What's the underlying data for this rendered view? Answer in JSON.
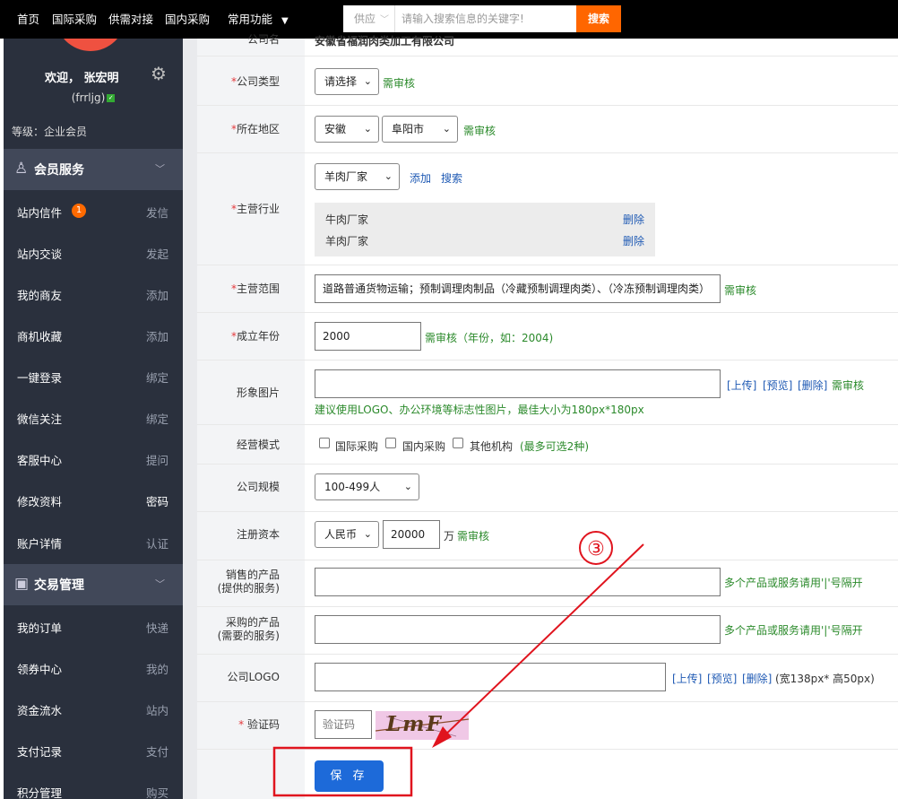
{
  "topnav": {
    "items": [
      "首页",
      "国际采购",
      "供需对接",
      "国内采购"
    ],
    "dropdown_label": "常用功能"
  },
  "search": {
    "category": "供应",
    "placeholder": "请输入搜索信息的关键字!",
    "button": "搜索"
  },
  "sidebar": {
    "welcome": "欢迎， 张宏明",
    "username": "(frrljg)",
    "level": "等级：企业会员",
    "section1": {
      "title": "会员服务",
      "items": [
        {
          "label": "站内信件",
          "action": "发信",
          "badge": "1"
        },
        {
          "label": "站内交谈",
          "action": "发起"
        },
        {
          "label": "我的商友",
          "action": "添加"
        },
        {
          "label": "商机收藏",
          "action": "添加"
        },
        {
          "label": "一键登录",
          "action": "绑定"
        },
        {
          "label": "微信关注",
          "action": "绑定"
        },
        {
          "label": "客服中心",
          "action": "提问"
        },
        {
          "label": "修改资料",
          "action": "密码"
        },
        {
          "label": "账户详情",
          "action": "认证"
        }
      ]
    },
    "section2": {
      "title": "交易管理",
      "items": [
        {
          "label": "我的订单",
          "action": "快递"
        },
        {
          "label": "领券中心",
          "action": "我的"
        },
        {
          "label": "资金流水",
          "action": "站内"
        },
        {
          "label": "支付记录",
          "action": "支付"
        },
        {
          "label": "积分管理",
          "action": "购买"
        }
      ]
    }
  },
  "form": {
    "company_name": {
      "label": "公司名",
      "value": "安徽省福润肉类加工有限公司"
    },
    "company_type": {
      "label": "公司类型",
      "value": "请选择",
      "note": "需审核"
    },
    "region": {
      "label": "所在地区",
      "province": "安徽",
      "city": "阜阳市",
      "note": "需审核"
    },
    "industry": {
      "label": "主营行业",
      "value": "羊肉厂家",
      "add": "添加",
      "search": "搜索",
      "selected": [
        {
          "name": "牛肉厂家",
          "action": "删除"
        },
        {
          "name": "羊肉厂家",
          "action": "删除"
        }
      ]
    },
    "business_scope": {
      "label": "主营范围",
      "value": "道路普通货物运输；预制调理肉制品（冷藏预制调理肉类）、（冷冻预制调理肉类）",
      "note": "需审核"
    },
    "founded_year": {
      "label": "成立年份",
      "value": "2000",
      "note": "需审核（年份，如：2004)"
    },
    "image": {
      "label": "形象图片",
      "upload": "[上传]",
      "preview": "[预览]",
      "delete": "[删除]",
      "note": "需审核",
      "hint": "建议使用LOGO、办公环境等标志性图片，最佳大小为180px*180px"
    },
    "business_mode": {
      "label": "经营模式",
      "options": [
        "国际采购",
        "国内采购",
        "其他机构"
      ],
      "hint": "(最多可选2种)"
    },
    "company_size": {
      "label": "公司规模",
      "value": "100-499人"
    },
    "registered_capital": {
      "label": "注册资本",
      "currency": "人民币",
      "amount": "20000",
      "unit": "万",
      "note": "需审核"
    },
    "products_sell": {
      "label1": "销售的产品",
      "label2": "(提供的服务)",
      "hint": "多个产品或服务请用'|'号隔开"
    },
    "products_buy": {
      "label1": "采购的产品",
      "label2": "(需要的服务)",
      "hint": "多个产品或服务请用'|'号隔开"
    },
    "logo": {
      "label": "公司LOGO",
      "upload": "[上传]",
      "preview": "[预览]",
      "delete": "[删除]",
      "size_hint": "(宽138px* 高50px)"
    },
    "captcha": {
      "label": "验证码",
      "placeholder": "验证码",
      "image_text": "LmF"
    },
    "save": "保 存"
  },
  "annotation": {
    "step": "③",
    "color": "#e0141e"
  }
}
